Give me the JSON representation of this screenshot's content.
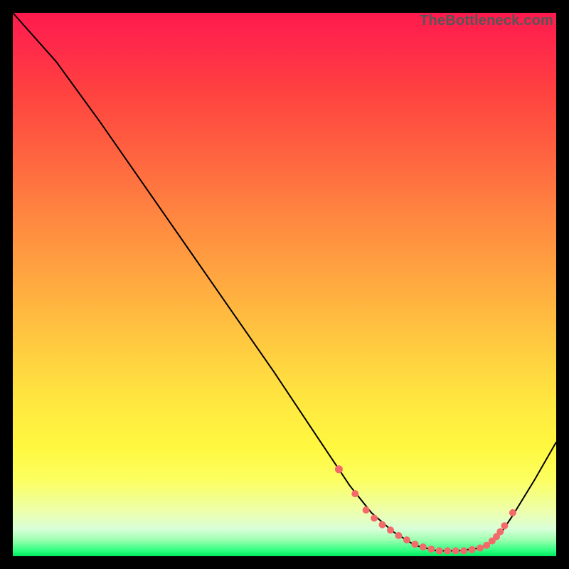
{
  "watermark": "TheBottleneck.com",
  "chart_data": {
    "type": "line",
    "title": "",
    "xlabel": "",
    "ylabel": "",
    "xlim": [
      0,
      100
    ],
    "ylim": [
      0,
      100
    ],
    "curve": {
      "name": "bottleneck-curve",
      "x": [
        0,
        8,
        16,
        24,
        32,
        40,
        48,
        56,
        62,
        66,
        70,
        74,
        78,
        82,
        86,
        88,
        90,
        92,
        96,
        100
      ],
      "y": [
        100,
        91,
        80,
        68.5,
        57,
        45.5,
        34,
        22,
        13,
        8,
        4.5,
        2,
        1,
        1,
        1.5,
        2.5,
        4.5,
        7.5,
        14,
        21
      ]
    },
    "markers": {
      "name": "highlight-dots",
      "color": "#f46a6a",
      "x": [
        60,
        63,
        65,
        66.5,
        68,
        69.5,
        71,
        72.5,
        74,
        75.5,
        77,
        78.5,
        80,
        81.5,
        83,
        84.5,
        86,
        87.2,
        88.2,
        89,
        89.7,
        90.5,
        92
      ],
      "y": [
        16,
        11.5,
        8.5,
        7,
        5.8,
        4.8,
        3.8,
        3.0,
        2.2,
        1.7,
        1.3,
        1.0,
        1.0,
        1.0,
        1.0,
        1.2,
        1.5,
        2.0,
        2.8,
        3.6,
        4.5,
        5.6,
        8.0
      ]
    },
    "background": {
      "type": "vertical-gradient",
      "stops": [
        {
          "pos": 0.0,
          "color": "#ff1a4d"
        },
        {
          "pos": 0.5,
          "color": "#ffb040"
        },
        {
          "pos": 0.8,
          "color": "#fff840"
        },
        {
          "pos": 0.97,
          "color": "#9cffb0"
        },
        {
          "pos": 1.0,
          "color": "#00e860"
        }
      ]
    }
  }
}
